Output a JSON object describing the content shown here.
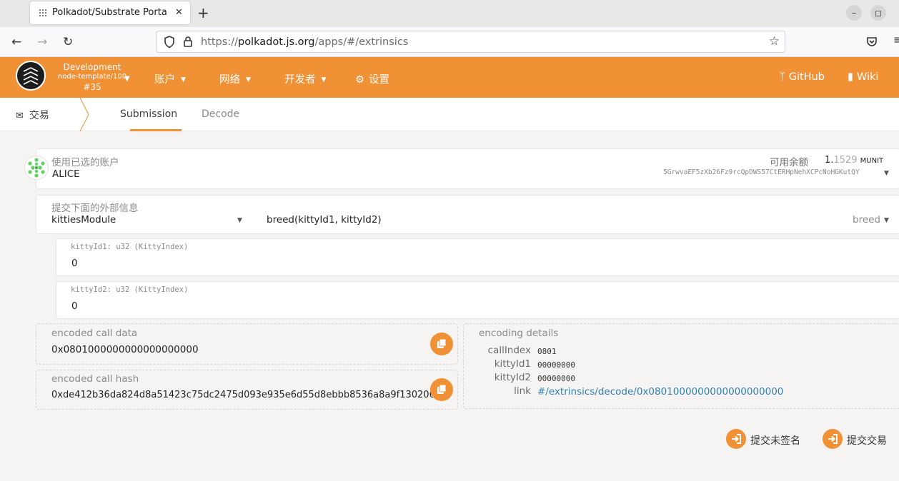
{
  "browser": {
    "tab_title": "Polkadot/Substrate Porta",
    "tab_close": "✕",
    "new_tab": "+",
    "url_prefix": "https://",
    "url_domain": "polkadot.js.org",
    "url_path": "/apps/#/extrinsics",
    "window_minimize": "–",
    "window_maximize": "◻"
  },
  "header": {
    "chain_name": "Development",
    "runtime": "node-template/100",
    "block": "#35",
    "menu": [
      {
        "label": "账户"
      },
      {
        "label": "网络"
      },
      {
        "label": "开发者"
      },
      {
        "label": "设置"
      }
    ],
    "links": [
      {
        "label": "GitHub"
      },
      {
        "label": "Wiki"
      }
    ],
    "accent_color": "#f19135"
  },
  "subnav": {
    "section": "交易",
    "tabs": [
      {
        "label": "Submission",
        "active": true
      },
      {
        "label": "Decode",
        "active": false
      }
    ]
  },
  "account": {
    "label": "使用已选的账户",
    "name": "ALICE",
    "balance_label": "可用余额",
    "balance_int": "1.",
    "balance_frac": "1529",
    "balance_unit": "MUNIT",
    "address": "5GrwvaEF5zXb26Fz9rcQpDWS57CtERHpNehXCPcNoHGKutQY"
  },
  "extrinsic": {
    "label": "提交下面的外部信息",
    "module": "kittiesModule",
    "call_signature": "breed(kittyId1, kittyId2)",
    "call": "breed"
  },
  "params": [
    {
      "label": "kittyId1: u32 (KittyIndex)",
      "value": "0"
    },
    {
      "label": "kittyId2: u32 (KittyIndex)",
      "value": "0"
    }
  ],
  "encoded_call_data": {
    "label": "encoded call data",
    "value": "0x0801000000000000000000"
  },
  "encoded_call_hash": {
    "label": "encoded call hash",
    "value": "0xde412b36da824d8a51423c75dc2475d093e935e6d55d8ebbb8536a8a9f130206"
  },
  "encoding_details": {
    "title": "encoding details",
    "rows": [
      {
        "key": "callIndex",
        "value": "0801"
      },
      {
        "key": "kittyId1",
        "value": "00000000"
      },
      {
        "key": "kittyId2",
        "value": "00000000"
      }
    ],
    "link_key": "link",
    "link_value": "#/extrinsics/decode/0x0801000000000000000000"
  },
  "actions": {
    "submit_unsigned": "提交未签名",
    "submit": "提交交易"
  }
}
